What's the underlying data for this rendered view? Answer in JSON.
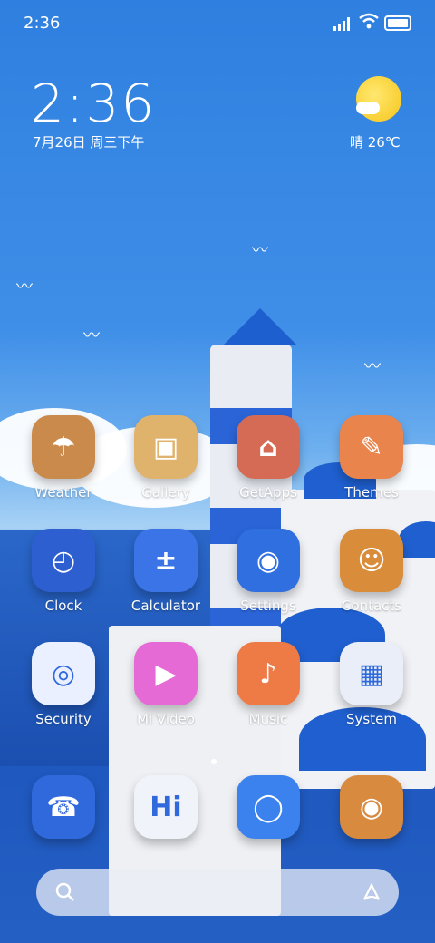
{
  "status_bar": {
    "time": "2:36"
  },
  "widget": {
    "clock": "2:36",
    "date": "7月26日 周三下午",
    "weather": "晴 26℃",
    "weather_icon": "sunny-cloud-icon"
  },
  "apps": [
    {
      "label": "Weather",
      "icon": "weather-icon",
      "color": "#c98a4c"
    },
    {
      "label": "Gallery",
      "icon": "gallery-icon",
      "color": "#e0b36d"
    },
    {
      "label": "GetApps",
      "icon": "getapps-icon",
      "color": "#d56a55"
    },
    {
      "label": "Themes",
      "icon": "themes-icon",
      "color": "#e9844c"
    },
    {
      "label": "Clock",
      "icon": "clock-icon",
      "color": "#2d5fd1"
    },
    {
      "label": "Calculator",
      "icon": "calculator-icon",
      "color": "#3a74e6"
    },
    {
      "label": "Settings",
      "icon": "settings-icon",
      "color": "#2f6fe0"
    },
    {
      "label": "Contacts",
      "icon": "contacts-icon",
      "color": "#d98c3a"
    },
    {
      "label": "Security",
      "icon": "security-icon",
      "color": "#eaf0ff"
    },
    {
      "label": "Mi Video",
      "icon": "mi-video-icon",
      "color": "#e66ad6"
    },
    {
      "label": "Music",
      "icon": "music-icon",
      "color": "#ee7a45"
    },
    {
      "label": "System",
      "icon": "system-folder-icon",
      "color": "#e9eef8"
    },
    {
      "label": "",
      "icon": "phone-icon",
      "color": "#2f69dc"
    },
    {
      "label": "",
      "icon": "messages-icon",
      "color": "#f0f3fa"
    },
    {
      "label": "",
      "icon": "browser-icon",
      "color": "#3b82ee"
    },
    {
      "label": "",
      "icon": "camera-icon",
      "color": "#d88a3f"
    }
  ],
  "page_indicator": {
    "current": 2,
    "total": 2
  },
  "dock": {
    "left_icon": "search-icon",
    "right_icon": "assistant-icon"
  }
}
